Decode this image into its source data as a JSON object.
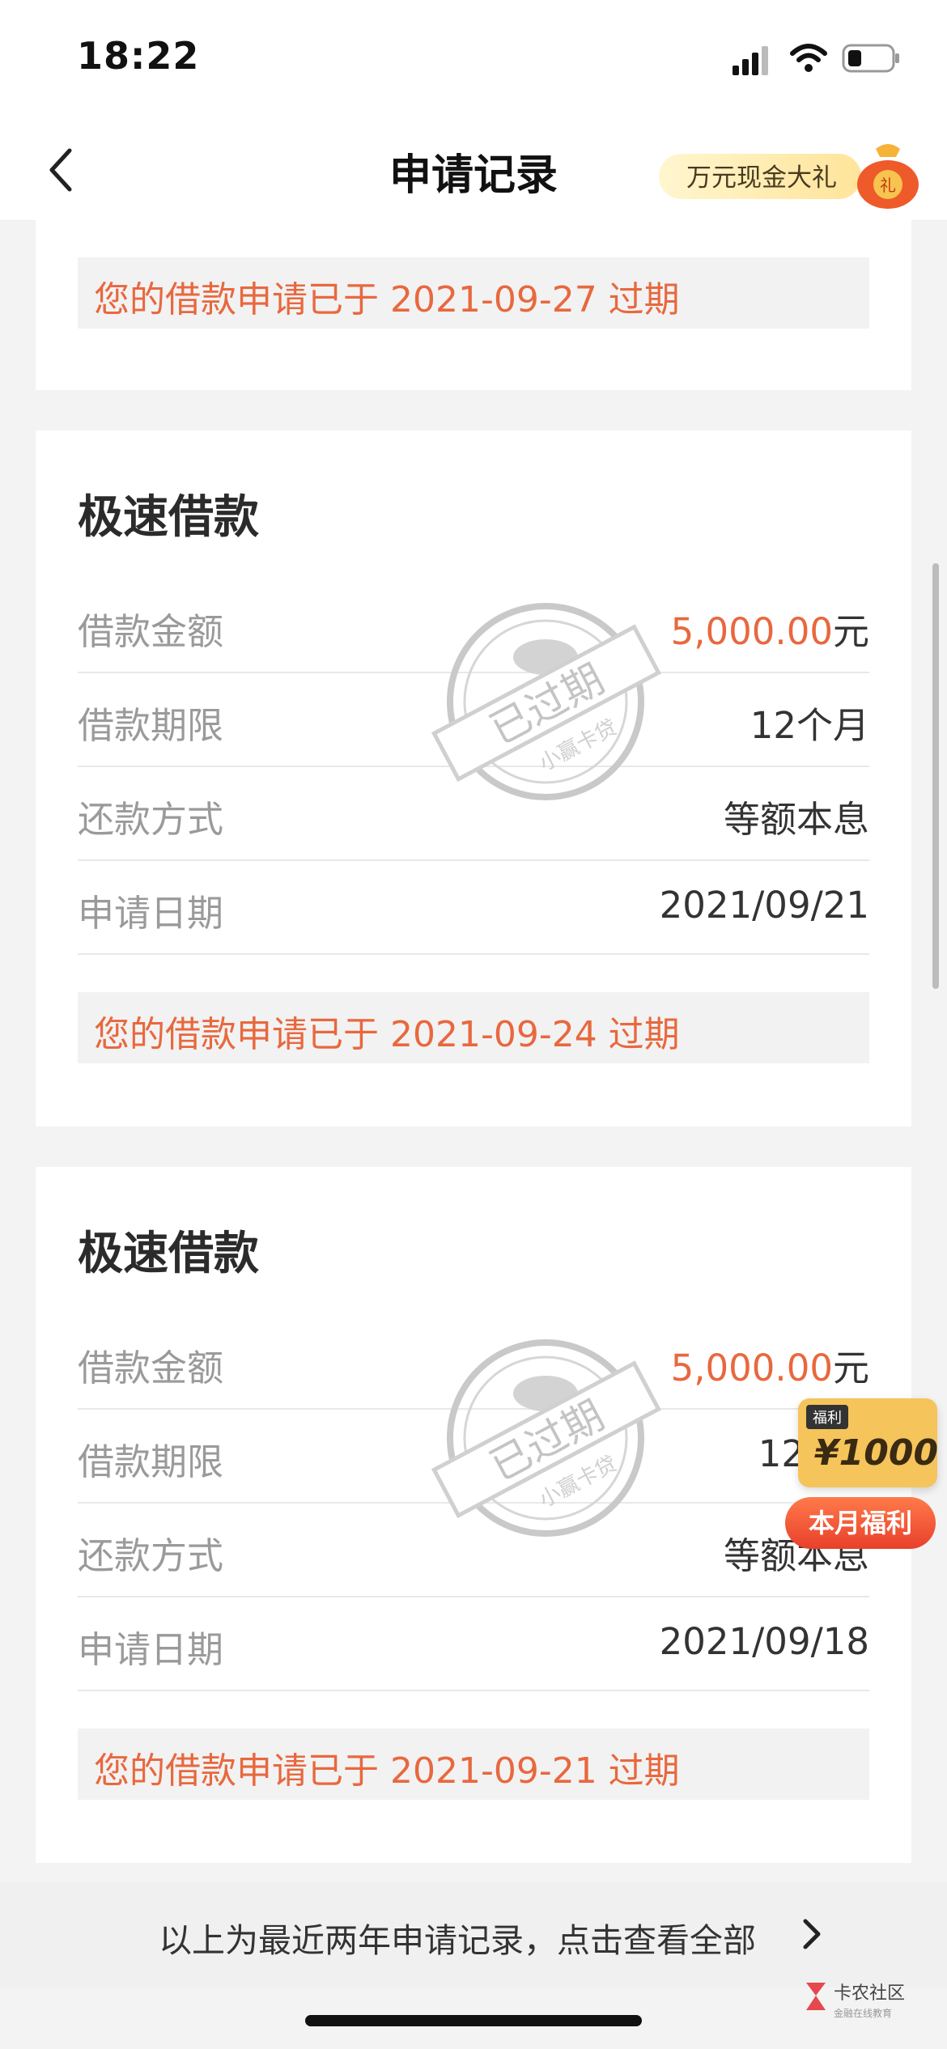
{
  "status_bar": {
    "time": "18:22"
  },
  "header": {
    "title": "申请记录",
    "promo_label": "万元现金大礼",
    "promo_bag_char": "礼"
  },
  "records": [
    {
      "expired_note": "您的借款申请已于 2021-09-27 过期"
    },
    {
      "title": "极速借款",
      "rows": [
        {
          "label": "借款金额",
          "value": "5,000.00",
          "unit": "元"
        },
        {
          "label": "借款期限",
          "value": "12个月"
        },
        {
          "label": "还款方式",
          "value": "等额本息"
        },
        {
          "label": "申请日期",
          "value": "2021/09/21"
        }
      ],
      "stamp": {
        "main": "已过期",
        "sub": "小赢卡贷"
      },
      "expired_note": "您的借款申请已于 2021-09-24 过期"
    },
    {
      "title": "极速借款",
      "rows": [
        {
          "label": "借款金额",
          "value": "5,000.00",
          "unit": "元"
        },
        {
          "label": "借款期限",
          "value": "12"
        },
        {
          "label": "还款方式",
          "value": "等额本息"
        },
        {
          "label": "申请日期",
          "value": "2021/09/18"
        }
      ],
      "stamp": {
        "main": "已过期",
        "sub": "小赢卡贷"
      },
      "expired_note": "您的借款申请已于 2021-09-21 过期"
    }
  ],
  "footer": {
    "text": "以上为最近两年申请记录，点击查看全部"
  },
  "bonus": {
    "tag": "福利",
    "amount": "¥1000",
    "button": "本月福利"
  },
  "watermark": {
    "line1": "卡农社区",
    "line2": "金融在线教育"
  },
  "colors": {
    "accent": "#e8683e",
    "background": "#f3f3f3"
  }
}
